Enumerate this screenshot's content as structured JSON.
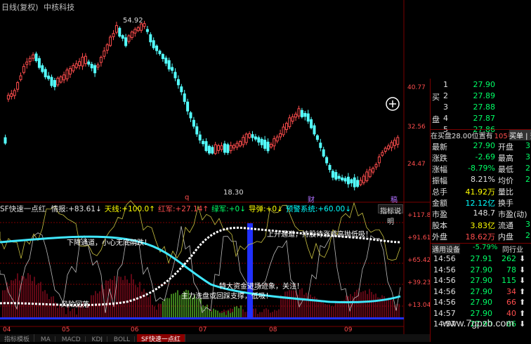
{
  "title_bar": {
    "period": "日线(复权)",
    "stock_name": "中核科技"
  },
  "price_axis": [
    "40.77",
    "32.56",
    "24.47"
  ],
  "price_annotations": {
    "high": "54.92",
    "low": "18.30"
  },
  "date_labels": [
    "04",
    "05",
    "06",
    "07",
    "08",
    "09"
  ],
  "event_markers": {
    "q": "q",
    "cai": "财",
    "gao": "稿"
  },
  "indicator": {
    "name": "SF快速一点红",
    "items": [
      {
        "label": "情报:",
        "value": "+83.61",
        "arrow": "↓",
        "color": "#e0e0e0"
      },
      {
        "label": "天线:",
        "value": "+100.0",
        "arrow": "↑",
        "color": "#ffff00"
      },
      {
        "label": "红军:",
        "value": "+27.14",
        "arrow": "↑",
        "color": "#ff4d4d"
      },
      {
        "label": "绿军:",
        "value": "+0",
        "arrow": "↓",
        "color": "#00ff66"
      },
      {
        "label": "导弹:",
        "value": "+0",
        "arrow": "↓",
        "color": "#ffff00"
      },
      {
        "label": "预警系统:",
        "value": "+60.00",
        "arrow": "↓",
        "color": "#00ffff"
      }
    ],
    "help_button": "指标说明",
    "axis": [
      "+117.8",
      "+91.61",
      "+65.42",
      "+39.23",
      "+13.04"
    ],
    "annotations": {
      "down_channel": "下降通道，小心无底阴跌！",
      "up_channel": "上升通道，持股待涨或高抛低吸！",
      "big_money": "特大资金进场迹象，关注！",
      "wash": "主力洗盘或回踩支撑，低吸！",
      "pullback": "风险回落"
    }
  },
  "bottom_tabs": [
    "指标模板",
    "MA",
    "MACD",
    "KDJ",
    "BOLL",
    "SF快速一点红"
  ],
  "order_book": {
    "sell_label": "买盘",
    "levels": [
      {
        "n": "1",
        "price": "27.90"
      },
      {
        "n": "2",
        "price": "27.89"
      },
      {
        "n": "3",
        "price": "27.88"
      },
      {
        "n": "4",
        "price": "27.87"
      },
      {
        "n": "5",
        "price": "27.86"
      }
    ]
  },
  "status_line": {
    "text": "在买盘28.00位置有",
    "qty": "105手",
    "btn": "买单 | 查看"
  },
  "quote": [
    {
      "l1": "最新",
      "v1": "27.90",
      "c1": "green",
      "l2": "开盘",
      "v2": "3"
    },
    {
      "l1": "涨跌",
      "v1": "-2.69",
      "c1": "green",
      "l2": "最高",
      "v2": "3"
    },
    {
      "l1": "涨幅",
      "v1": "-8.79%",
      "c1": "green",
      "l2": "最低",
      "v2": "2"
    },
    {
      "l1": "振幅",
      "v1": "8.21%",
      "c1": "white",
      "l2": "均价",
      "v2": "2"
    },
    {
      "l1": "总手",
      "v1": "41.92万",
      "c1": "yellow",
      "l2": "量比",
      "v2": ""
    },
    {
      "l1": "金额",
      "v1": "12.12亿",
      "c1": "cyan",
      "l2": "换手",
      "v2": ""
    },
    {
      "l1": "市盈",
      "v1": "148.7",
      "c1": "white",
      "l2": "市盈(动)",
      "v2": ""
    },
    {
      "l1": "股本",
      "v1": "3.83亿",
      "c1": "yellow",
      "l2": "流通",
      "v2": "3"
    },
    {
      "l1": "外盘",
      "v1": "18.62万",
      "c1": "red",
      "l2": "内盘",
      "v2": "2"
    }
  ],
  "industry": {
    "label": "通用设备",
    "change": "-5.79%",
    "tab": "同行业"
  },
  "ticks": [
    {
      "time": "14:56",
      "price": "27.91",
      "vol": "262",
      "dir": "down"
    },
    {
      "time": "14:56",
      "price": "27.90",
      "vol": "78",
      "dir": "down"
    },
    {
      "time": "14:56",
      "price": "27.90",
      "vol": "115",
      "dir": "down"
    },
    {
      "time": "14:56",
      "price": "27.90",
      "vol": "34",
      "dir": "up"
    },
    {
      "time": "14:56",
      "price": "27.90",
      "vol": "66",
      "dir": "up"
    },
    {
      "time": "14:57",
      "price": "27.90",
      "vol": "40",
      "dir": "up"
    },
    {
      "time": "14:57",
      "price": "27.90",
      "vol": "66",
      "dir": "down"
    }
  ],
  "watermark": "www.7gpzb.com"
}
